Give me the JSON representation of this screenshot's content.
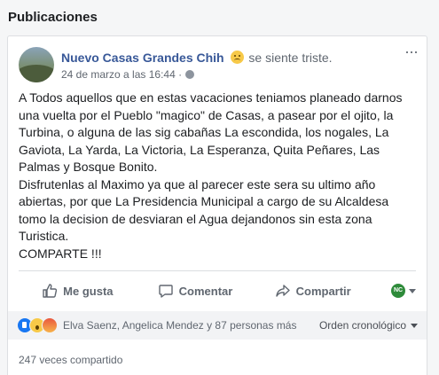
{
  "section": {
    "title": "Publicaciones"
  },
  "post": {
    "author": "Nuevo Casas Grandes Chih",
    "feeling": "se siente triste.",
    "timestamp": "24 de marzo a las 16:44 ·",
    "text": "A Todos aquellos que en estas vacaciones teniamos planeado darnos\nuna vuelta por el Pueblo \"magico\" de Casas, a pasear por el ojito, la\nTurbina, o alguna de las sig cabañas La escondida, los nogales, La\nGaviota, La Yarda, La Victoria, La Esperanza, Quita Peñares, Las\nPalmas y Bosque Bonito.\nDisfrutenlas al Maximo ya que al parecer este sera su ultimo año\nabiertas, por que La Presidencia Municipal a cargo de su Alcaldesa\ntomo la decision de desviaran el Agua dejandonos sin esta zona\nTuristica.\nCOMPARTE !!!",
    "more_icon": "···"
  },
  "actions": {
    "like_label": "Me gusta",
    "comment_label": "Comentar",
    "share_label": "Compartir"
  },
  "reactions": {
    "icons": [
      "like-icon",
      "wow-icon",
      "angry-icon"
    ],
    "summary": "Elva Saenz, Angelica Mendez y 87 personas más",
    "sort_label": "Orden cronológico"
  },
  "shares": {
    "text": "247 veces compartido"
  },
  "colors": {
    "link": "#385898",
    "like": "#1877f2",
    "muted": "#606770"
  }
}
